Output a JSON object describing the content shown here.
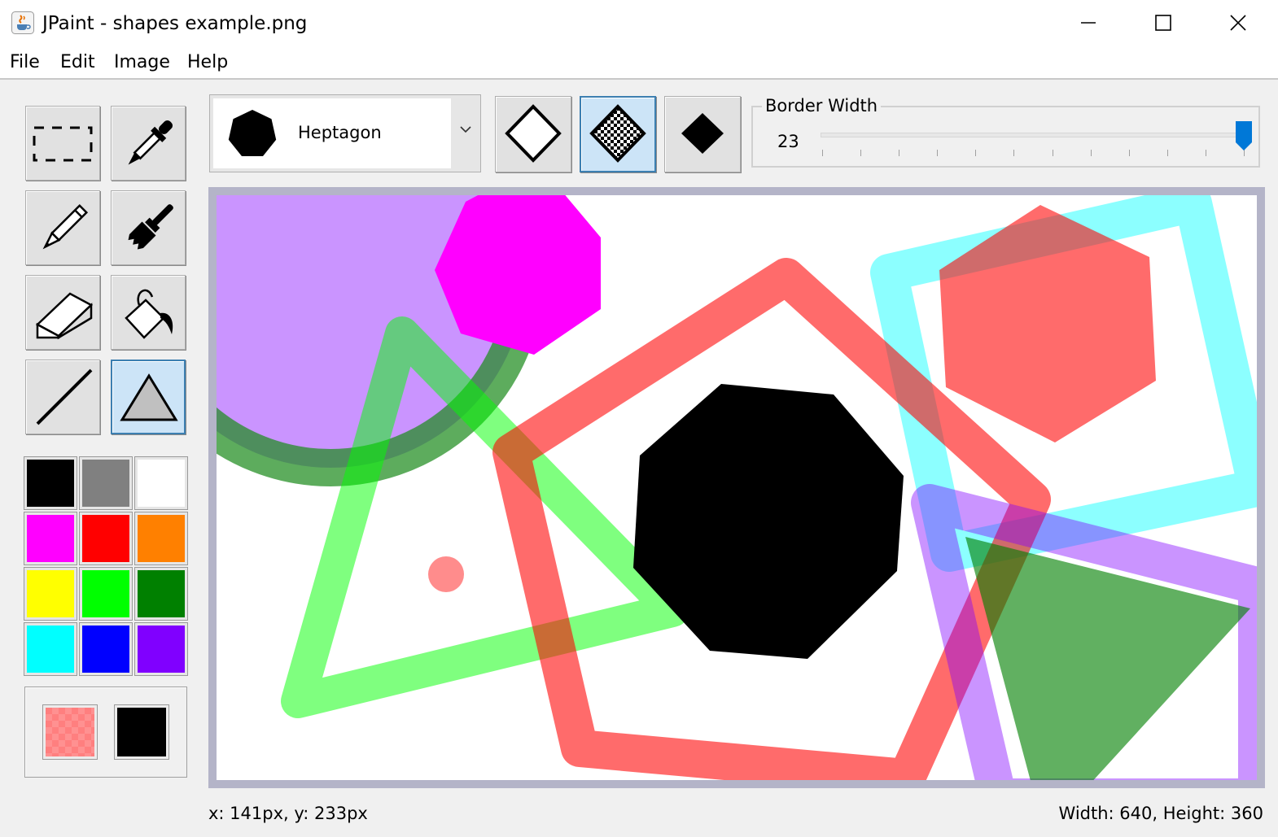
{
  "window": {
    "title": "JPaint - shapes example.png",
    "app_icon": "java-cup-icon",
    "controls": [
      "minimize-icon",
      "maximize-icon",
      "close-icon"
    ]
  },
  "menu": {
    "items": [
      {
        "label": "File"
      },
      {
        "label": "Edit"
      },
      {
        "label": "Image"
      },
      {
        "label": "Help"
      }
    ]
  },
  "tools": {
    "items": [
      {
        "name": "select",
        "icon": "dashed-rectangle-icon",
        "selected": false
      },
      {
        "name": "eyedropper",
        "icon": "eyedropper-icon",
        "selected": false
      },
      {
        "name": "pencil",
        "icon": "pencil-icon",
        "selected": false
      },
      {
        "name": "brush",
        "icon": "paintbrush-icon",
        "selected": false
      },
      {
        "name": "eraser",
        "icon": "eraser-icon",
        "selected": false
      },
      {
        "name": "fill",
        "icon": "paint-bucket-icon",
        "selected": false
      },
      {
        "name": "line",
        "icon": "line-icon",
        "selected": false
      },
      {
        "name": "shape",
        "icon": "triangle-icon",
        "selected": true
      }
    ]
  },
  "palette": {
    "colors": [
      "#000000",
      "#808080",
      "#ffffff",
      "#ff00ff",
      "#ff0000",
      "#ff8000",
      "#ffff00",
      "#00ff00",
      "#008000",
      "#00ffff",
      "#0000ff",
      "#8000ff"
    ]
  },
  "current_colors": {
    "fill": "#ff7f7f",
    "fill_transparent": true,
    "stroke": "#000000"
  },
  "shape_selector": {
    "selected": "Heptagon",
    "icon": "heptagon-icon"
  },
  "fill_modes": [
    {
      "name": "outline",
      "icon": "diamond-outline-icon",
      "selected": false
    },
    {
      "name": "outline-and-fill",
      "icon": "diamond-checkered-icon",
      "selected": true
    },
    {
      "name": "fill",
      "icon": "diamond-filled-icon",
      "selected": false
    }
  ],
  "border_width": {
    "label": "Border Width",
    "value": "23",
    "slider_fraction": 1.0
  },
  "status": {
    "cursor": "x: 141px, y: 233px",
    "size": "Width: 640, Height: 360"
  }
}
